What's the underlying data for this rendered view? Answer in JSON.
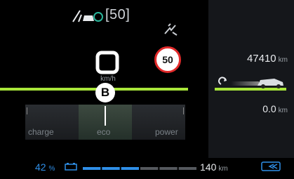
{
  "top_status": {
    "speed_limit_label": "[50]"
  },
  "speed": {
    "value_symbol": "0",
    "unit": "km/h"
  },
  "speed_limit_sign": "50",
  "gear": "B",
  "odometer": {
    "value": "47410",
    "unit": "km"
  },
  "trip": {
    "value": "0.0",
    "unit": "km"
  },
  "gauge": {
    "labels": [
      "charge",
      "eco",
      "power"
    ]
  },
  "battery": {
    "percent": "42",
    "percent_unit": "%",
    "level": 0.42
  },
  "range": {
    "value": "140",
    "unit": "km"
  },
  "colors": {
    "accent_green": "#a8e63a",
    "accent_blue": "#2f8fe8",
    "limit_red": "#e12a2a"
  },
  "icons": [
    "lane-assist-icon",
    "adaptive-cruise-icon",
    "hands-on-wheel-icon",
    "car-side-icon",
    "battery-icon",
    "regen-brake-icon",
    "loop-arrow-icon"
  ]
}
